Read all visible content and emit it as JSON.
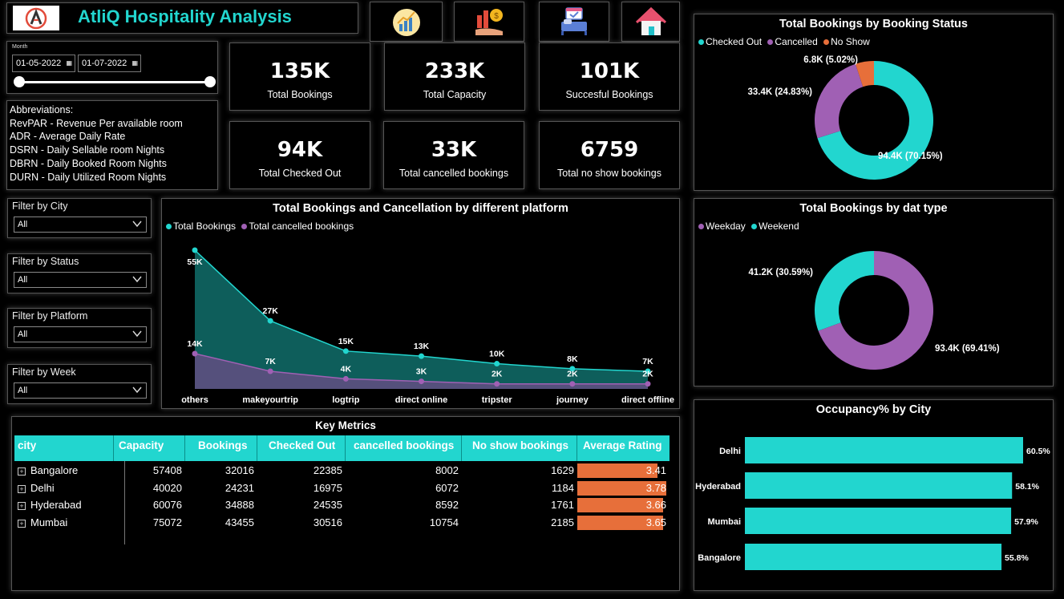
{
  "header": {
    "title": "AtliQ Hospitality Analysis"
  },
  "month_filter": {
    "label": "Month",
    "start": "01-05-2022",
    "end": "01-07-2022"
  },
  "abbreviations": [
    "Abbreviations:",
    "RevPAR - Revenue Per available room",
    "ADR - Average Daily Rate",
    "DSRN - Daily Sellable room Nights",
    "DBRN - Daily Booked Room Nights",
    "DURN - Daily Utilized Room Nights"
  ],
  "kpis": [
    {
      "value": "135K",
      "label": "Total Bookings"
    },
    {
      "value": "233K",
      "label": "Total Capacity"
    },
    {
      "value": "101K",
      "label": "Succesful Bookings"
    },
    {
      "value": "94K",
      "label": "Total Checked Out"
    },
    {
      "value": "33K",
      "label": "Total cancelled bookings"
    },
    {
      "value": "6759",
      "label": "Total no show bookings"
    }
  ],
  "filters": [
    {
      "label": "Filter by City",
      "value": "All"
    },
    {
      "label": "Filter by Status",
      "value": "All"
    },
    {
      "label": "Filter by Platform",
      "value": "All"
    },
    {
      "label": "Filter by Week",
      "value": "All"
    }
  ],
  "colors": {
    "teal": "#22d6cf",
    "purple": "#a060b4",
    "orange": "#e76f3a",
    "area_dark": "#0e5e5b"
  },
  "chart_data": [
    {
      "type": "pie",
      "title": "Total Bookings by Booking Status",
      "categories": [
        "Checked Out",
        "Cancelled",
        "No Show"
      ],
      "values": [
        94.4,
        33.4,
        6.8
      ],
      "labels": [
        "94.4K (70.15%)",
        "33.4K (24.83%)",
        "6.8K (5.02%)"
      ],
      "colors": [
        "#22d6cf",
        "#a060b4",
        "#e76f3a"
      ],
      "legend": "top-left"
    },
    {
      "type": "area",
      "title": "Total Bookings and Cancellation by different platform",
      "categories": [
        "others",
        "makeyourtrip",
        "logtrip",
        "direct online",
        "tripster",
        "journey",
        "direct offline"
      ],
      "series": [
        {
          "name": "Total Bookings",
          "values": [
            55,
            27,
            15,
            13,
            10,
            8,
            7
          ],
          "labels": [
            "55K",
            "27K",
            "15K",
            "13K",
            "10K",
            "8K",
            "7K"
          ],
          "color": "#22d6cf"
        },
        {
          "name": "Total cancelled bookings",
          "values": [
            14,
            7,
            4,
            3,
            2,
            2,
            2
          ],
          "labels": [
            "14K",
            "7K",
            "4K",
            "3K",
            "2K",
            "2K",
            "2K"
          ],
          "color": "#a060b4"
        }
      ],
      "legend": "top-left"
    },
    {
      "type": "pie",
      "title": "Total Bookings by dat type",
      "categories": [
        "Weekday",
        "Weekend"
      ],
      "values": [
        93.4,
        41.2
      ],
      "labels": [
        "93.4K (69.41%)",
        "41.2K (30.59%)"
      ],
      "colors": [
        "#a060b4",
        "#22d6cf"
      ],
      "legend": "top-left"
    },
    {
      "type": "bar",
      "title": "Occupancy% by City",
      "categories": [
        "Delhi",
        "Hyderabad",
        "Mumbai",
        "Bangalore"
      ],
      "values": [
        60.5,
        58.1,
        57.9,
        55.8
      ],
      "labels": [
        "60.5%",
        "58.1%",
        "57.9%",
        "55.8%"
      ],
      "color": "#22d6cf"
    }
  ],
  "table": {
    "title": "Key Metrics",
    "columns": [
      "city",
      "Capacity",
      "Bookings",
      "Checked Out",
      "cancelled bookings",
      "No show bookings",
      "Average Rating"
    ],
    "rows": [
      [
        "Bangalore",
        "57408",
        "32016",
        "22385",
        "8002",
        "1629",
        "3.41"
      ],
      [
        "Delhi",
        "40020",
        "24231",
        "16975",
        "6072",
        "1184",
        "3.78"
      ],
      [
        "Hyderabad",
        "60076",
        "34888",
        "24535",
        "8592",
        "1761",
        "3.66"
      ],
      [
        "Mumbai",
        "75072",
        "43455",
        "30516",
        "10754",
        "2185",
        "3.65"
      ]
    ],
    "ratings": [
      3.41,
      3.78,
      3.66,
      3.65
    ],
    "expand_glyph": "+"
  },
  "icons": [
    "growth-chart-icon",
    "money-bars-icon",
    "hotel-bed-icon",
    "home-icon",
    "calendar-icon",
    "chevron-down-icon",
    "expand-icon"
  ]
}
